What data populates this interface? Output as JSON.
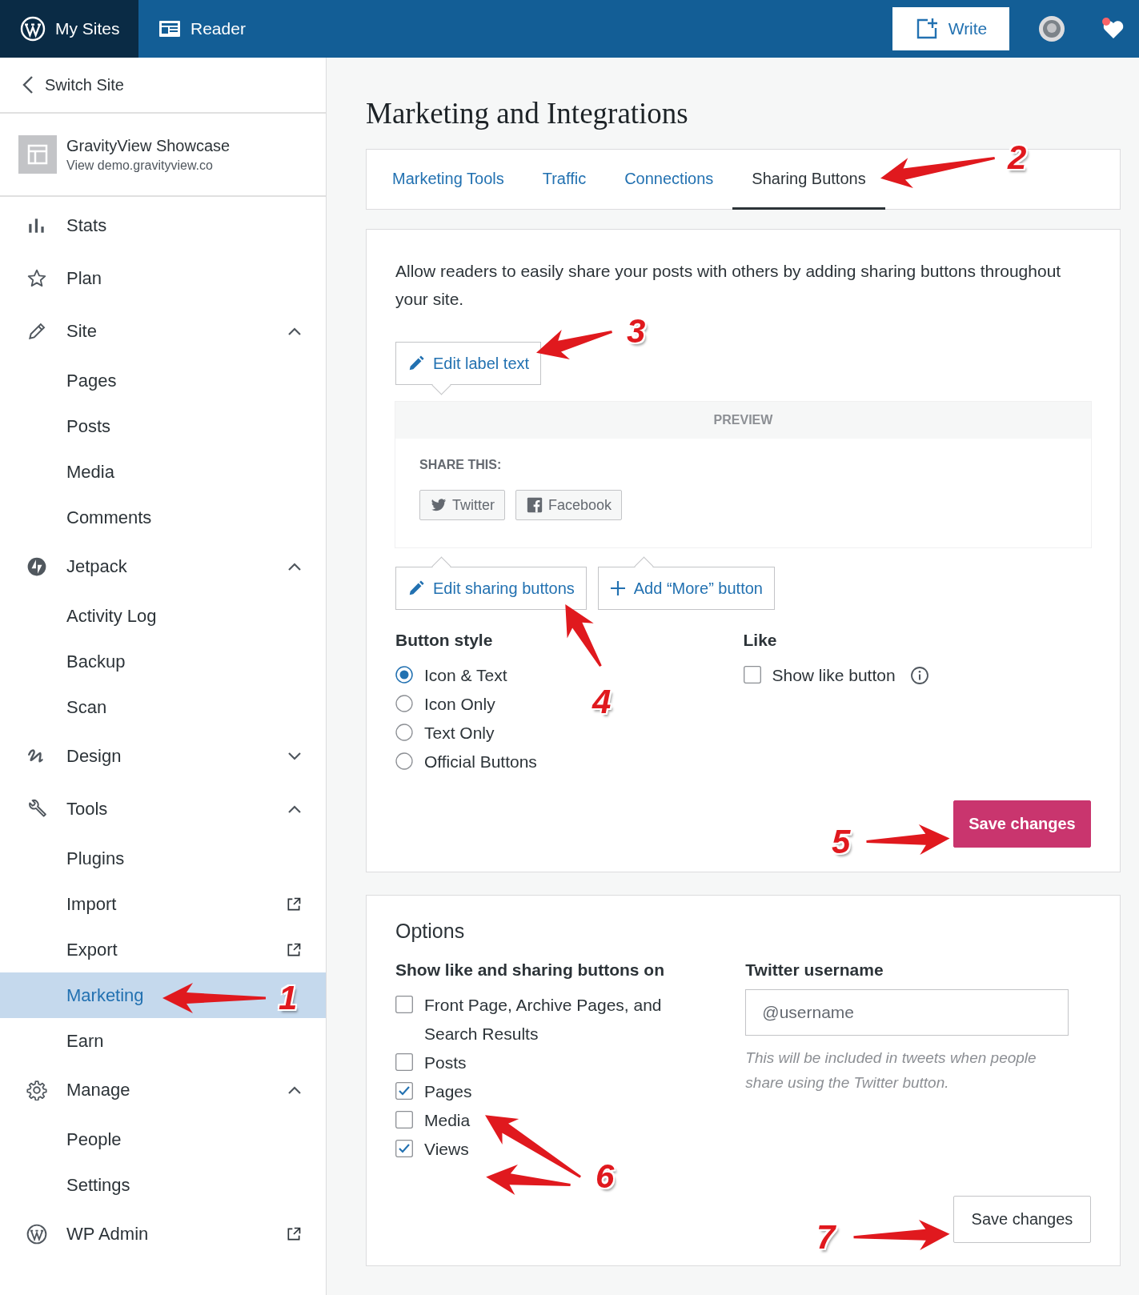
{
  "topbar": {
    "my_sites": "My Sites",
    "reader": "Reader",
    "write": "Write"
  },
  "sidebar": {
    "switch_site": "Switch Site",
    "site": {
      "name": "GravityView Showcase",
      "url": "View demo.gravityview.co"
    },
    "menu": [
      {
        "label": "Stats"
      },
      {
        "label": "Plan"
      },
      {
        "label": "Site",
        "expanded": true,
        "children": [
          {
            "label": "Pages",
            "selected": false
          },
          {
            "label": "Posts",
            "selected": false
          },
          {
            "label": "Media",
            "selected": false
          },
          {
            "label": "Comments",
            "selected": false
          }
        ]
      },
      {
        "label": "Jetpack",
        "expanded": true,
        "children": [
          {
            "label": "Activity Log",
            "selected": false
          },
          {
            "label": "Backup",
            "selected": false
          },
          {
            "label": "Scan",
            "selected": false
          }
        ]
      },
      {
        "label": "Design",
        "expanded": false
      },
      {
        "label": "Tools",
        "expanded": true,
        "children": [
          {
            "label": "Plugins",
            "selected": false
          },
          {
            "label": "Import",
            "selected": false,
            "external": true
          },
          {
            "label": "Export",
            "selected": false,
            "external": true
          },
          {
            "label": "Marketing",
            "selected": true
          },
          {
            "label": "Earn",
            "selected": false
          }
        ]
      },
      {
        "label": "Manage",
        "expanded": true,
        "children": [
          {
            "label": "People",
            "selected": false
          },
          {
            "label": "Settings",
            "selected": false
          }
        ]
      },
      {
        "label": "WP Admin",
        "external": true
      }
    ]
  },
  "page": {
    "title": "Marketing and Integrations",
    "tabs": [
      {
        "label": "Marketing Tools",
        "selected": false
      },
      {
        "label": "Traffic",
        "selected": false
      },
      {
        "label": "Connections",
        "selected": false
      },
      {
        "label": "Sharing Buttons",
        "selected": true
      }
    ],
    "sharing": {
      "description": "Allow readers to easily share your posts with others by adding sharing buttons throughout your site.",
      "edit_label": "Edit label text",
      "preview": {
        "header": "PREVIEW",
        "share_this": "SHARE THIS:",
        "buttons": [
          "Twitter",
          "Facebook"
        ]
      },
      "edit_buttons": "Edit sharing buttons",
      "add_more": "Add “More” button",
      "button_style": {
        "heading": "Button style",
        "options": [
          {
            "label": "Icon & Text",
            "selected": true
          },
          {
            "label": "Icon Only",
            "selected": false
          },
          {
            "label": "Text Only",
            "selected": false
          },
          {
            "label": "Official Buttons",
            "selected": false
          }
        ]
      },
      "like": {
        "heading": "Like",
        "label": "Show like button",
        "checked": false
      },
      "save": "Save changes"
    },
    "options": {
      "heading": "Options",
      "show_on": {
        "heading": "Show like and sharing buttons on",
        "items": [
          {
            "label": "Front Page, Archive Pages, and Search Results",
            "checked": false
          },
          {
            "label": "Posts",
            "checked": false
          },
          {
            "label": "Pages",
            "checked": true
          },
          {
            "label": "Media",
            "checked": false
          },
          {
            "label": "Views",
            "checked": true
          }
        ]
      },
      "twitter": {
        "heading": "Twitter username",
        "placeholder": "@username",
        "help": "This will be included in tweets when people share using the Twitter button."
      },
      "save": "Save changes"
    }
  },
  "annotations": [
    {
      "number": "1"
    },
    {
      "number": "2"
    },
    {
      "number": "3"
    },
    {
      "number": "4"
    },
    {
      "number": "5"
    },
    {
      "number": "6"
    },
    {
      "number": "7"
    }
  ]
}
